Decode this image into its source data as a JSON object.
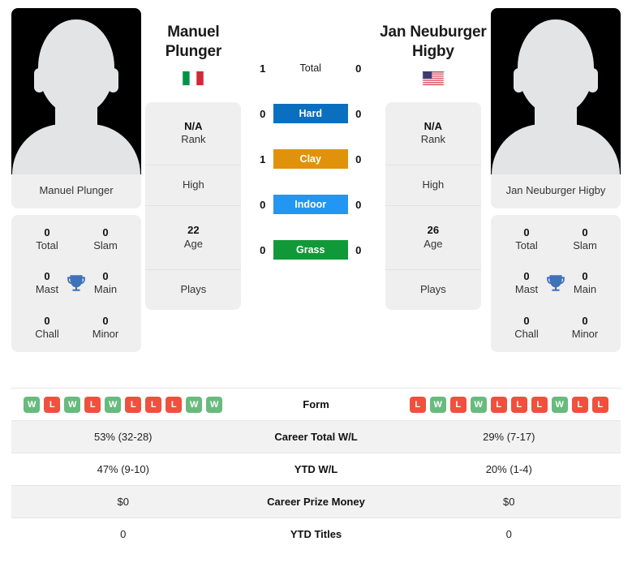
{
  "players": {
    "left": {
      "name_line1": "Manuel",
      "name_line2": "Plunger",
      "full_name": "Manuel Plunger",
      "flag": "italy-flag",
      "rank_value": "N/A",
      "rank_label": "Rank",
      "high_label": "High",
      "age_value": "22",
      "age_label": "Age",
      "plays_label": "Plays",
      "titles": [
        {
          "num": "0",
          "lbl": "Total"
        },
        {
          "num": "0",
          "lbl": "Slam"
        },
        {
          "num": "0",
          "lbl": "Mast"
        },
        {
          "num": "0",
          "lbl": "Main"
        },
        {
          "num": "0",
          "lbl": "Chall"
        },
        {
          "num": "0",
          "lbl": "Minor"
        }
      ],
      "form": [
        "W",
        "L",
        "W",
        "L",
        "W",
        "L",
        "L",
        "L",
        "W",
        "W"
      ],
      "career_wl": "53% (32-28)",
      "ytd_wl": "47% (9-10)",
      "prize_money": "$0",
      "ytd_titles": "0"
    },
    "right": {
      "name_line1": "Jan Neuburger",
      "name_line2": "Higby",
      "full_name": "Jan Neuburger Higby",
      "flag": "usa-flag",
      "rank_value": "N/A",
      "rank_label": "Rank",
      "high_label": "High",
      "age_value": "26",
      "age_label": "Age",
      "plays_label": "Plays",
      "titles": [
        {
          "num": "0",
          "lbl": "Total"
        },
        {
          "num": "0",
          "lbl": "Slam"
        },
        {
          "num": "0",
          "lbl": "Mast"
        },
        {
          "num": "0",
          "lbl": "Main"
        },
        {
          "num": "0",
          "lbl": "Chall"
        },
        {
          "num": "0",
          "lbl": "Minor"
        }
      ],
      "form": [
        "L",
        "W",
        "L",
        "W",
        "L",
        "L",
        "L",
        "W",
        "L",
        "L"
      ],
      "career_wl": "29% (7-17)",
      "ytd_wl": "20% (1-4)",
      "prize_money": "$0",
      "ytd_titles": "0"
    }
  },
  "h2h": {
    "rows": [
      {
        "label": "Total",
        "left": "1",
        "right": "0",
        "color": "",
        "style": "plain"
      },
      {
        "label": "Hard",
        "left": "0",
        "right": "0",
        "color": "#0b6fc0",
        "style": "badge"
      },
      {
        "label": "Clay",
        "left": "1",
        "right": "0",
        "color": "#e0930a",
        "style": "badge"
      },
      {
        "label": "Indoor",
        "left": "0",
        "right": "0",
        "color": "#2196f3",
        "style": "badge"
      },
      {
        "label": "Grass",
        "left": "0",
        "right": "0",
        "color": "#119939",
        "style": "badge"
      }
    ]
  },
  "stats_table": {
    "rows": [
      {
        "label": "Form",
        "type": "form"
      },
      {
        "label": "Career Total W/L",
        "type": "text",
        "key": "career_wl"
      },
      {
        "label": "YTD W/L",
        "type": "text",
        "key": "ytd_wl"
      },
      {
        "label": "Career Prize Money",
        "type": "text",
        "key": "prize_money"
      },
      {
        "label": "YTD Titles",
        "type": "text",
        "key": "ytd_titles"
      }
    ]
  },
  "colors": {
    "card_bg": "#efefef",
    "row_shade": "#f2f2f2",
    "win_badge": "#68bb7d",
    "loss_badge": "#f0503e",
    "trophy": "#3f72b8"
  }
}
